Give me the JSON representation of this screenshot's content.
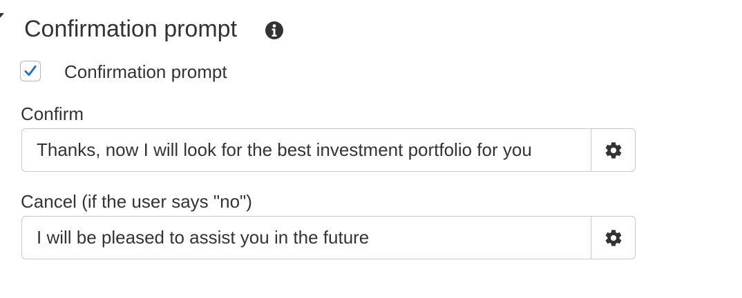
{
  "section": {
    "title": "Confirmation prompt"
  },
  "checkbox": {
    "label": "Confirmation prompt",
    "checked": true,
    "check_color": "#2a6cd5"
  },
  "confirm": {
    "label": "Confirm",
    "value": "Thanks, now I will look for the best investment portfolio for you"
  },
  "cancel": {
    "label": "Cancel (if the user says \"no\")",
    "value": "I will be pleased to assist you in the future"
  },
  "icons": {
    "section_caret": "caret-down-icon",
    "info": "info-icon",
    "settings": "gear-icon"
  }
}
